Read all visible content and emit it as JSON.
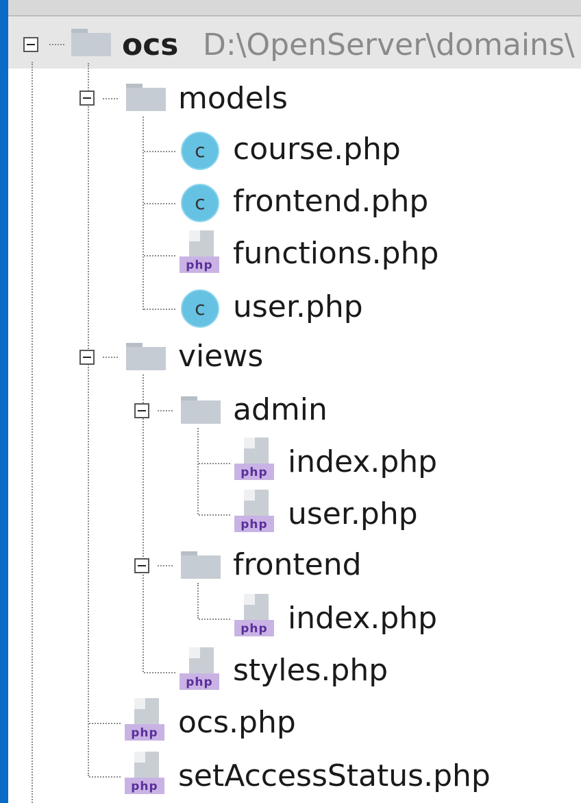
{
  "project": {
    "name": "ocs",
    "path": "D:\\OpenServer\\domains\\"
  },
  "tree": {
    "models": {
      "label": "models",
      "files": [
        "course.php",
        "frontend.php",
        "functions.php",
        "user.php"
      ]
    },
    "views": {
      "label": "views",
      "admin": {
        "label": "admin",
        "files": [
          "index.php",
          "user.php"
        ]
      },
      "frontend": {
        "label": "frontend",
        "files": [
          "index.php"
        ]
      },
      "files": [
        "styles.php"
      ]
    },
    "root_files": [
      "ocs.php",
      "setAccessStatus.php"
    ]
  },
  "icons": {
    "class_letter": "c",
    "php_badge": "php"
  },
  "colors": {
    "window_frame": "#0a6cc6",
    "class_icon": "#66c2e2",
    "php_badge": "#c9b3e4",
    "folder": "#c6ccd3"
  }
}
